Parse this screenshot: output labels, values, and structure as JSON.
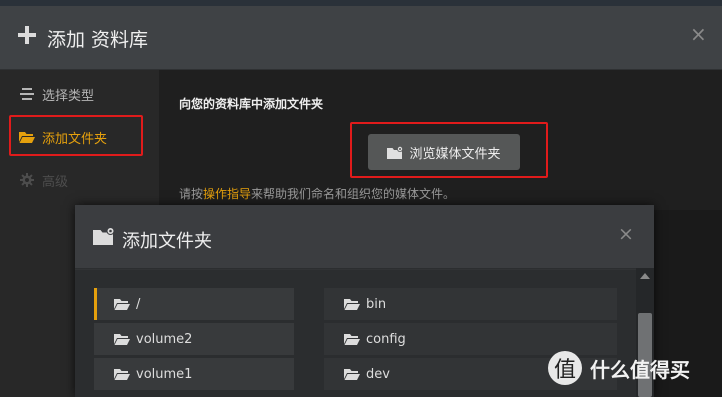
{
  "header": {
    "title": "添加 资料库",
    "close": "×"
  },
  "sidebar": {
    "items": [
      {
        "label": "选择类型",
        "icon": "list-icon"
      },
      {
        "label": "添加文件夹",
        "icon": "folder-icon"
      },
      {
        "label": "高级",
        "icon": "gear-icon"
      }
    ]
  },
  "main": {
    "prompt": "向您的资料库中添加文件夹",
    "browse_button": "浏览媒体文件夹",
    "help_prefix": "请按",
    "help_link": "操作指导",
    "help_suffix": "来帮助我们命名和组织您的媒体文件。"
  },
  "dialog": {
    "title": "添加文件夹",
    "close": "×",
    "left_folders": [
      "/",
      "volume2",
      "volume1"
    ],
    "right_folders": [
      "bin",
      "config",
      "dev"
    ]
  },
  "watermark": {
    "logo": "值",
    "text": "什么值得买"
  },
  "colors": {
    "accent": "#e5a00d",
    "highlight_box": "#e01b1b"
  }
}
